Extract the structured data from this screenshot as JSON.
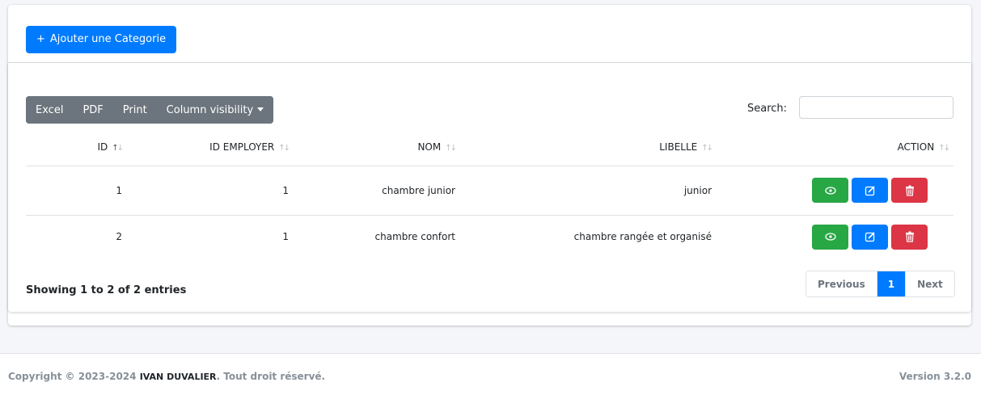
{
  "header": {
    "add_button_icon": "plus-icon",
    "add_button_label": "Ajouter une Categorie"
  },
  "toolbar": {
    "excel_label": "Excel",
    "pdf_label": "PDF",
    "print_label": "Print",
    "colvis_label": "Column visibility",
    "search_label": "Search:",
    "search_value": ""
  },
  "table": {
    "columns": [
      "ID",
      "ID EMPLOYER",
      "NOM",
      "LIBELLE",
      "ACTION"
    ],
    "rows": [
      {
        "id": "1",
        "id_employer": "1",
        "nom": "chambre junior",
        "libelle": "junior"
      },
      {
        "id": "2",
        "id_employer": "1",
        "nom": "chambre confort",
        "libelle": "chambre rangée et organisé"
      }
    ],
    "action_icons": [
      "eye-icon",
      "edit-icon",
      "trash-icon"
    ]
  },
  "info_text": "Showing 1 to 2 of 2 entries",
  "pagination": {
    "previous_label": "Previous",
    "current_page": "1",
    "next_label": "Next"
  },
  "footer": {
    "copyright_prefix": "Copyright © 2023-2024",
    "author": "IVAN DUVALIER",
    "copyright_suffix": ". Tout droit réservé.",
    "version": "Version 3.2.0"
  },
  "colors": {
    "primary": "#007bff",
    "success": "#28a745",
    "danger": "#dc3545",
    "secondary": "#6c757d"
  }
}
